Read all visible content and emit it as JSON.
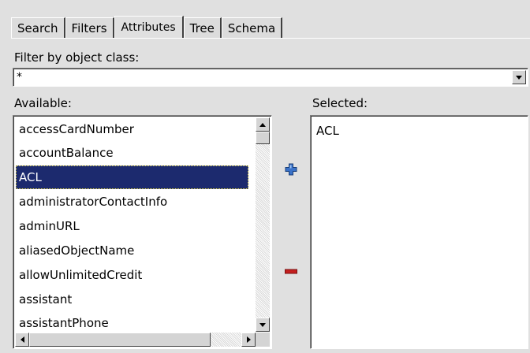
{
  "tabs": [
    {
      "label": "Search"
    },
    {
      "label": "Filters"
    },
    {
      "label": "Attributes"
    },
    {
      "label": "Tree"
    },
    {
      "label": "Schema"
    }
  ],
  "active_tab": "Attributes",
  "filter": {
    "label": "Filter by object class:",
    "value": "*"
  },
  "available": {
    "label": "Available:",
    "items": [
      "accessCardNumber",
      "accountBalance",
      "ACL",
      "administratorContactInfo",
      "adminURL",
      "aliasedObjectName",
      "allowUnlimitedCredit",
      "assistant",
      "assistantPhone"
    ],
    "selected_item": "ACL"
  },
  "selected": {
    "label": "Selected:",
    "items": [
      "ACL"
    ]
  },
  "icons": {
    "add": "plus-icon",
    "remove": "minus-icon"
  },
  "colors": {
    "add_icon": "#3a72c8",
    "remove_icon": "#c41e1e",
    "selection_bg": "#1c2a6e"
  }
}
